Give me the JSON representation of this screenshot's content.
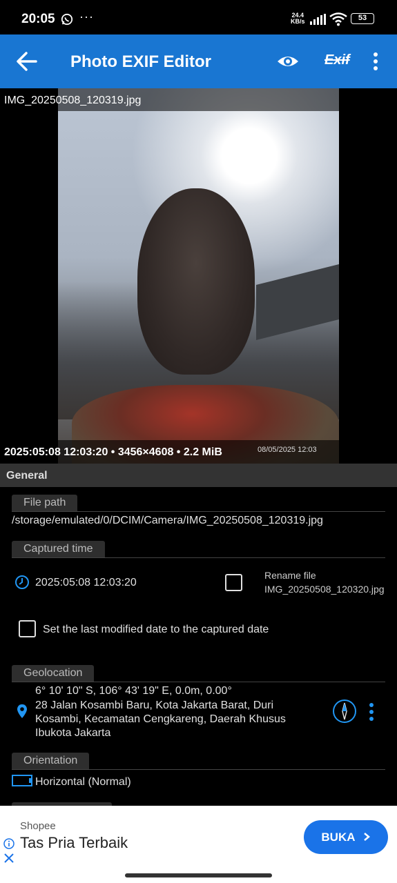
{
  "status_bar": {
    "time": "20:05",
    "dots": "···",
    "speed_value": "24.4",
    "speed_unit": "KB/s",
    "battery": "53"
  },
  "app_bar": {
    "title": "Photo EXIF Editor",
    "exif_label": "Exif"
  },
  "photo": {
    "file_name": "IMG_20250508_120319.jpg",
    "meta": "2025:05:08 12:03:20 • 3456×4608 • 2.2 MiB",
    "stamp": "08/05/2025 12:03"
  },
  "general": {
    "section_title": "General",
    "file_path_label": "File path",
    "file_path": "/storage/emulated/0/DCIM/Camera/IMG_20250508_120319.jpg",
    "captured_time_label": "Captured time",
    "captured_time": "2025:05:08 12:03:20",
    "rename_label": "Rename file",
    "rename_value": "IMG_20250508_120320.jpg",
    "modified_checkbox_label": "Set the last modified date to the captured date",
    "geolocation_label": "Geolocation",
    "coords": "6° 10' 10\" S, 106° 43' 19\" E,  0.0m, 0.00°",
    "address_line1": "28 Jalan Kosambi Baru, Kota Jakarta Barat, Duri",
    "address_line2": "Kosambi, Kecamatan Cengkareng, Daerah Khusus",
    "address_line3": "Ibukota Jakarta",
    "orientation_label": "Orientation",
    "orientation_value": "Horizontal (Normal)"
  },
  "ad": {
    "brand": "Shopee",
    "headline": "Tas Pria Terbaik",
    "cta": "BUKA"
  },
  "colors": {
    "app_bar": "#1976d2",
    "accent": "#1a73e8",
    "icon_blue": "#2196f3"
  }
}
